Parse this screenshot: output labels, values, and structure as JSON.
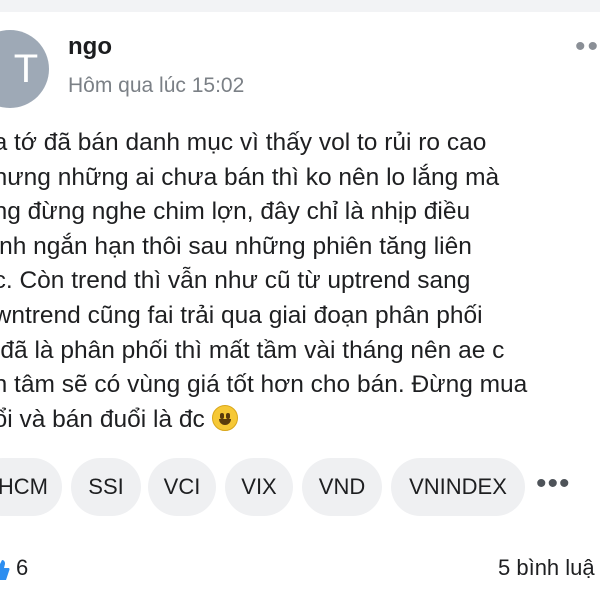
{
  "post": {
    "author": "ngo",
    "avatar_letter": "T",
    "timestamp": "Hôm qua lúc 15:02",
    "body_lines": [
      "ua tớ đã bán danh mục vì thấy vol to rủi ro cao",
      "nhưng những ai chưa bán thì ko nên lo lắng mà",
      "ũng đừng nghe chim lợn, đây chỉ là nhịp điều",
      "hỉnh ngắn hạn thôi sau những phiên tăng liên",
      "ục. Còn trend thì vẫn như cũ từ uptrend sang",
      "owntrend cũng fai trải qua giai đoạn phân phối",
      "à đã là phân phối thì mất tầm vài tháng nên ae c",
      "ên tâm sẽ có vùng giá tốt hơn cho bán. Đừng mua",
      "uổi và bán đuổi là đc"
    ],
    "emoji": "grinning-face-emoji"
  },
  "tags": [
    "HCM",
    "SSI",
    "VCI",
    "VIX",
    "VND",
    "VNINDEX"
  ],
  "footer": {
    "like_count": "6",
    "comments": "5 bình luậ"
  },
  "icons": {
    "more_top": "more-horizontal-icon",
    "more_tags": "more-horizontal-icon",
    "like": "like-icon"
  },
  "colors": {
    "avatar_bg": "#9ea9b6",
    "tag_bg": "#eff0f2",
    "secondary_text": "#7b8086",
    "like_blue": "#2d8ef0"
  }
}
